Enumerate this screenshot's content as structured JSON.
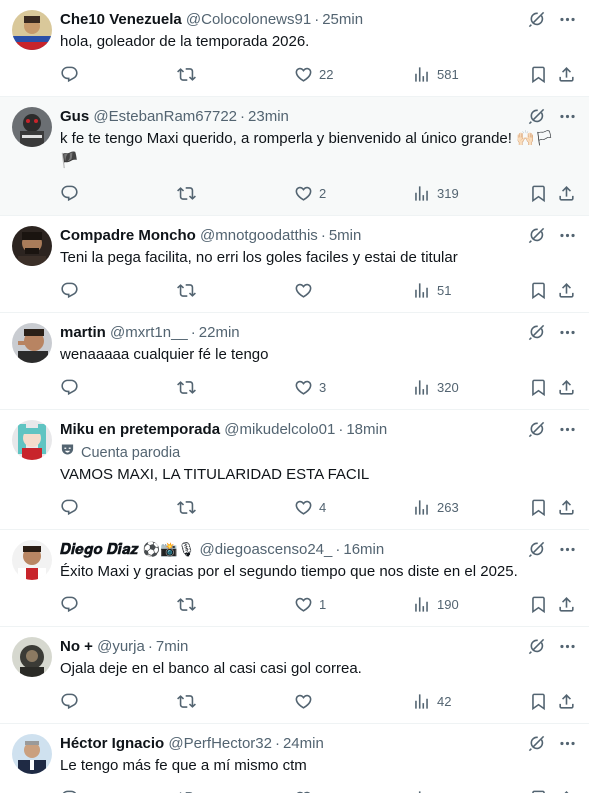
{
  "tweets": [
    {
      "name": "Che10 Venezuela",
      "handle": "@Colocolonews91",
      "time": "25min",
      "text": "hola, goleador de la temporada 2026.",
      "likes": "22",
      "views": "581",
      "retweets": "",
      "replies": ""
    },
    {
      "name": "Gus",
      "handle": "@EstebanRam67722",
      "time": "23min",
      "text": "k fe te tengo Maxi querido, a romperla y bienvenido al único grande! 🙌🏻🏳",
      "text2": "🏴",
      "likes": "2",
      "views": "319",
      "retweets": "",
      "replies": ""
    },
    {
      "name": "Compadre Moncho",
      "handle": "@mnotgoodatthis",
      "time": "5min",
      "text": "Teni la pega facilita, no erri los goles faciles y estai de  titular",
      "likes": "",
      "views": "51",
      "retweets": "",
      "replies": ""
    },
    {
      "name": "martin",
      "handle": "@mxrt1n__",
      "time": "22min",
      "text": "wenaaaaa cualquier fé le tengo",
      "likes": "3",
      "views": "320",
      "retweets": "",
      "replies": ""
    },
    {
      "name": "Miku en pretemporada",
      "handle": "@mikudelcolo01",
      "time": "18min",
      "parody": "Cuenta parodia",
      "text": "VAMOS MAXI, LA TITULARIDAD ESTA FACIL",
      "likes": "4",
      "views": "263",
      "retweets": "",
      "replies": ""
    },
    {
      "name": "𝑫𝒊𝒆𝒈𝒐 𝑫𝒊́𝒂𝒛",
      "name_emoji": "⚽📸🎙",
      "handle": "@diegoascenso24_",
      "time": "16min",
      "text": "Éxito Maxi y gracias por el segundo tiempo que nos diste en el 2025.",
      "likes": "1",
      "views": "190",
      "retweets": "",
      "replies": ""
    },
    {
      "name": "No +",
      "handle": "@yurja",
      "time": "7min",
      "text": "Ojala deje en el banco al casi casi gol correa.",
      "likes": "",
      "views": "42",
      "retweets": "",
      "replies": ""
    },
    {
      "name": "Héctor Ignacio",
      "handle": "@PerfHector32",
      "time": "24min",
      "text": "Le tengo más fe que a mí mismo ctm",
      "likes": "",
      "views": "",
      "retweets": "",
      "replies": ""
    }
  ],
  "icons": {
    "grok": "grok-icon",
    "more": "more-icon",
    "reply": "reply-icon",
    "retweet": "retweet-icon",
    "like": "heart-icon",
    "views": "views-icon",
    "bookmark": "bookmark-icon",
    "share": "share-icon",
    "parody": "parody-mask-icon"
  },
  "colors": {
    "text": "#0f1419",
    "secondary": "#536471",
    "border": "#eff3f4",
    "highlight_bg": "#f7f9f9"
  }
}
